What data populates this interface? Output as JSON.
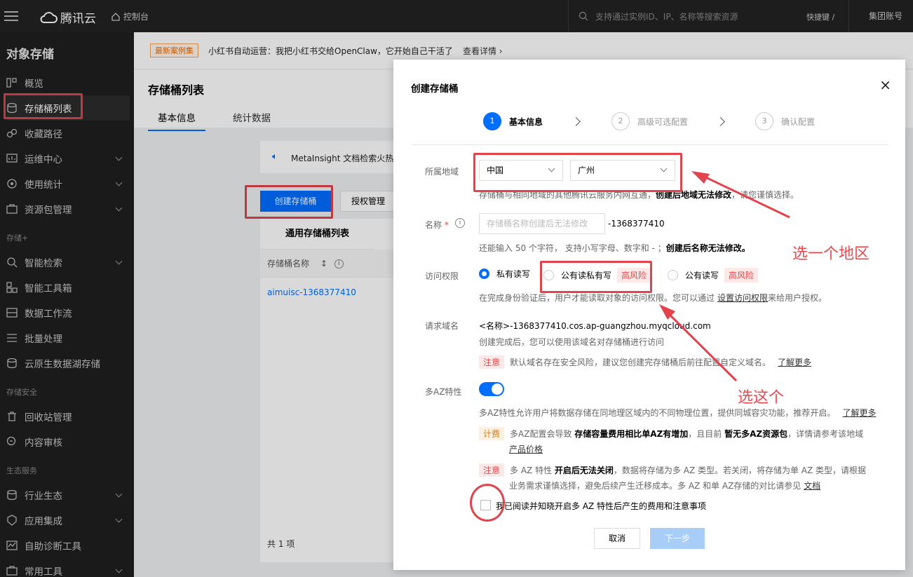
{
  "topbar": {
    "brand": "腾讯云",
    "console": "控制台",
    "search_placeholder": "支持通过实例ID、IP、名称等搜索资源",
    "shortcut": "快捷键 /",
    "account": "集团账号"
  },
  "sidebar": {
    "title": "对象存储",
    "items": [
      {
        "label": "概览",
        "icon": "overview-icon"
      },
      {
        "label": "存储桶列表",
        "icon": "bucket-icon"
      },
      {
        "label": "收藏路径",
        "icon": "link-icon"
      },
      {
        "label": "运维中心",
        "icon": "monitor-icon"
      },
      {
        "label": "使用统计",
        "icon": "stats-icon"
      },
      {
        "label": "资源包管理",
        "icon": "package-icon"
      },
      {
        "label": "智能检索",
        "icon": "ai-search-icon"
      },
      {
        "label": "智能工具箱",
        "icon": "toolbox-icon"
      },
      {
        "label": "数据工作流",
        "icon": "workflow-icon"
      },
      {
        "label": "批量处理",
        "icon": "batch-icon"
      },
      {
        "label": "云原生数据湖存储",
        "icon": "datalake-icon"
      },
      {
        "label": "回收站管理",
        "icon": "trash-icon"
      },
      {
        "label": "内容审核",
        "icon": "audit-icon"
      },
      {
        "label": "行业生态",
        "icon": "industry-icon"
      },
      {
        "label": "应用集成",
        "icon": "integration-icon"
      },
      {
        "label": "自助诊断工具",
        "icon": "diagnose-icon"
      },
      {
        "label": "常用工具",
        "icon": "tools-icon"
      }
    ],
    "groups": [
      "存储+",
      "存储安全",
      "生态服务"
    ]
  },
  "notice": {
    "badge": "最新案例集",
    "text": "小红书自动运营：我把小红书交给OpenClaw，它开始自己干活了",
    "link": "查看详情 ›"
  },
  "page": {
    "title": "存储桶列表",
    "tabs": [
      "基本信息",
      "统计数据"
    ],
    "banner": "MetaInsight 文档检索火热",
    "create_btn": "创建存储桶",
    "auth_btn": "授权管理",
    "list_tab": "通用存储桶列表",
    "col_name": "存储桶名称",
    "sort_icon": "↕",
    "bucket": "aimuisc-1368377410",
    "total": "共 1 项"
  },
  "modal": {
    "title": "创建存储桶",
    "close": "×",
    "steps": [
      {
        "num": "1",
        "label": "基本信息"
      },
      {
        "num": "2",
        "label": "高级可选配置"
      },
      {
        "num": "3",
        "label": "确认配置"
      }
    ],
    "region_label": "所属地域",
    "region_country": "中国",
    "region_city": "广州",
    "region_hint_pre": "存储桶与相同地域的其他腾讯云服务内网互通，",
    "region_hint_bold": "创建后地域无法修改",
    "region_hint_post": "，请您谨慎选择。",
    "name_label": "名称",
    "name_required": "*",
    "name_placeholder": "存储桶名称创建后无法修改",
    "name_suffix": "-1368377410",
    "name_hint_pre": "还能输入 50 个字符， 支持小写字母、数字和 - ；",
    "name_hint_bold": "创建后名称无法修改。",
    "access_label": "访问权限",
    "access_options": [
      {
        "label": "私有读写",
        "risk": ""
      },
      {
        "label": "公有读私有写",
        "risk": "高风险"
      },
      {
        "label": "公有读写",
        "risk": "高风险"
      }
    ],
    "access_hint_pre": "在完成身份验证后，用户才能读取对象的访问权限。您可以通过",
    "access_hint_link": "设置访问权限",
    "access_hint_post": "来给用户授权。",
    "domain_label": "请求域名",
    "domain_value": "<名称>-1368377410.cos.ap-guangzhou.myqcloud.com",
    "domain_hint": "创建完成后，您可以使用该域名对存储桶进行访问",
    "domain_tag": "注意",
    "domain_warn": "默认域名存在安全风险，建议您创建完存储桶后前往配置自定义域名。",
    "domain_more": "了解更多",
    "az_label": "多AZ特性",
    "az_desc": "多AZ特性允许用户将数据存储在同地理区域内的不同物理位置，提供同城容灾功能，推荐开启。",
    "az_more": "了解更多",
    "fee_tag": "计费",
    "fee_pre": "多AZ配置会导致",
    "fee_bold1": "存储容量费用相比单AZ有增加",
    "fee_mid": "，且目前",
    "fee_bold2": "暂无多AZ资源包",
    "fee_post": "，详情请参考该地域",
    "fee_link": "产品价格",
    "note_tag": "注意",
    "note_pre": "多 AZ 特性",
    "note_bold": "开启后无法关闭",
    "note_post": "，数据将存储为多 AZ 类型。若关闭，将存储为单 AZ 类型，请根据",
    "note_line2": "业务需求谨慎选择，避免后续产生迁移成本。多 AZ 和单 AZ存储的对比请参见",
    "note_link": "文档",
    "agree": "我已阅读并知晓开启多 AZ 特性后产生的费用和注意事项",
    "cancel": "取消",
    "next": "下一步"
  },
  "annotations": {
    "region": "选一个地区",
    "access": "选这个"
  },
  "colors": {
    "accent": "#006eff",
    "annotation": "#e2434c"
  }
}
